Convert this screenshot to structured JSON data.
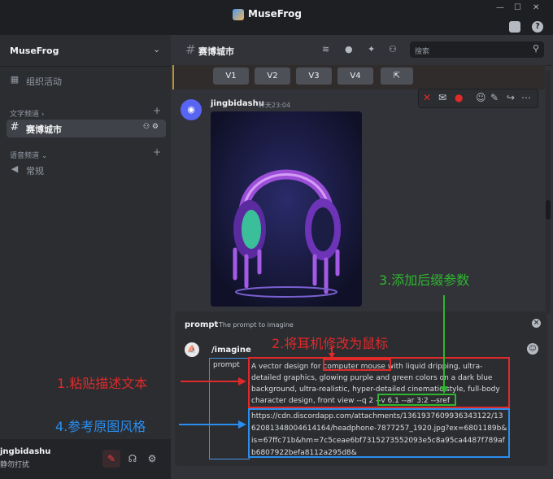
{
  "app": {
    "title": "MuseFrog"
  },
  "window": {
    "minimize": "—",
    "maximize": "☐",
    "close": "✕"
  },
  "titlebar": {
    "inbox_icon": "inbox-icon",
    "help_icon": "help-icon",
    "help_glyph": "?"
  },
  "sidebar": {
    "server_name": "MuseFrog",
    "chevron": "⌄",
    "events_label": "组织活动",
    "text_category": "文字频道 ›",
    "voice_category": "语音频道 ⌄",
    "plus": "+",
    "text_channel": "赛博城市",
    "voice_channel": "常规",
    "hash": "#"
  },
  "user": {
    "name": "jngbidashu",
    "status": "静勿打扰"
  },
  "channel": {
    "hash": "#",
    "title": "赛博城市"
  },
  "search": {
    "placeholder": "搜索"
  },
  "buttons": {
    "v1": "V1",
    "v2": "V2",
    "v3": "V3",
    "v4": "V4"
  },
  "message": {
    "author": "jingbidashu",
    "time": "昨天23:04"
  },
  "command": {
    "name": "prompt",
    "desc": "The prompt to imagine",
    "slash": "/imagine",
    "option_label": "prompt"
  },
  "prompt": {
    "pre": "A vector design for ",
    "subject": "computer mouse",
    "body": " with liquid dripping, ultra-detailed graphics, glowing purple and green colors on a dark blue background, ultra-realistic, hyper-detailed cinematic style, full-body character design, front view ",
    "params": "--q 2 --v 6.1 --ar 3:2",
    "tail": " --sref",
    "url": "https://cdn.discordapp.com/attachments/1361937609936343122/1362081348004614164/headphone-7877257_1920.jpg?ex=6801189b&is=67ffc71b&hm=7c5ceae6bf7315273552093e5c8a95ca4487f789afb6807922befa8112a295d8&"
  },
  "annotations": {
    "a1": "1.粘贴描述文本",
    "a2": "2.将耳机修改为鼠标",
    "a3": "3.添加后缀参数",
    "a4": "4.参考原图风格"
  },
  "colors": {
    "red": "#e02a2a",
    "blue": "#2a8ef0",
    "green": "#2fb52f"
  }
}
